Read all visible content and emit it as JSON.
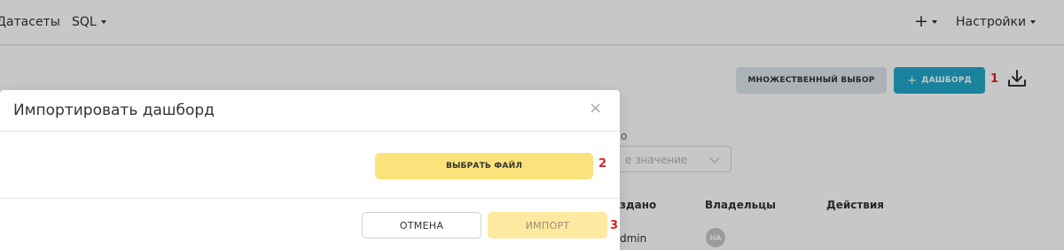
{
  "navbar": {
    "datasets_label": "Датасеты",
    "sql_label": "SQL",
    "plus_label": "+",
    "settings_label": "Настройки"
  },
  "toolbar": {
    "multi_select_label": "МНОЖЕСТВЕННЫЙ ВЫБОР",
    "dashboard_plus": "+",
    "dashboard_label": "ДАШБОРД",
    "step1": "1"
  },
  "filter": {
    "label": "о",
    "placeholder": "е значение"
  },
  "table": {
    "headers": [
      "здано",
      "Владельцы",
      "Действия"
    ],
    "row": {
      "created_by": "dmin",
      "owner_initials": "HA"
    }
  },
  "modal": {
    "title": "Импортировать дашборд",
    "close": "×",
    "choose_file_label": "ВЫБРАТЬ ФАЙЛ",
    "step2": "2",
    "cancel_label": "ОТМЕНА",
    "import_label": "ИМПОРТ",
    "step3": "3"
  },
  "colors": {
    "primary": "#20a7c9",
    "yellow_button": "#fce27a",
    "yellow_disabled": "#fde9a0",
    "annotation_red": "#e02020"
  },
  "icons": {
    "download": "download-icon",
    "close": "close-icon",
    "chevron": "chevron-down-icon"
  }
}
